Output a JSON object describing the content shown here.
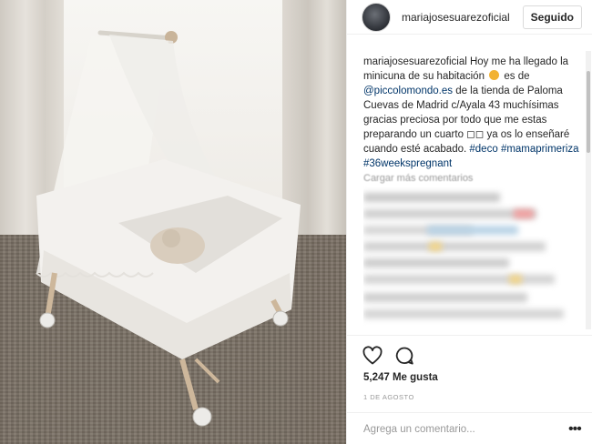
{
  "post": {
    "username": "mariajosesuarezoficial",
    "follow_label": "Seguido",
    "caption": {
      "author": "mariajosesuarezoficial",
      "text_1": "Hoy me ha llegado la minicuna de su habitación",
      "text_2": "es de",
      "mention": "@piccolomondo.es",
      "text_3": "de la tienda de Paloma Cuevas de Madrid c/Ayala 43 muchísimas gracias preciosa por todo que me estas preparando un cuarto ◻◻ ya os lo enseñaré cuando esté acabado.",
      "hashtag_1": "#deco",
      "hashtag_2": "#mamaprimeriza",
      "hashtag_3": "#36weekspregnant"
    },
    "load_more_comments": "Cargar más comentarios",
    "likes": "5,247 Me gusta",
    "date": "1 DE AGOSTO",
    "comment_placeholder": "Agrega un comentario...",
    "more_options": "•••"
  },
  "icons": {
    "like": "heart-outline-icon",
    "comment": "speech-bubble-icon"
  },
  "colors": {
    "link": "#003569",
    "muted": "#999999",
    "text": "#262626",
    "border": "#efefef"
  }
}
